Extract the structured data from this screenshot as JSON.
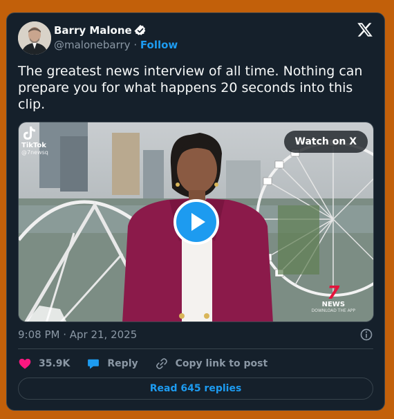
{
  "author": {
    "name": "Barry Malone",
    "handle": "@malonebarry",
    "separator": "·",
    "follow_label": "Follow"
  },
  "tweet": {
    "text": "The greatest news interview of all time. Nothing can prepare you for what happens 20 seconds into this clip."
  },
  "media": {
    "watch_label": "Watch on X",
    "overlay_tiktok": "TikTok",
    "overlay_tiktok_handle": "@7newsq",
    "overlay_channel_number": "7",
    "overlay_channel_name": "NEWS",
    "overlay_channel_sub": "DOWNLOAD THE APP"
  },
  "timestamp": "9:08 PM · Apr 21, 2025",
  "actions": {
    "likes": "35.9K",
    "reply_label": "Reply",
    "copy_label": "Copy link to post"
  },
  "read_replies_label": "Read 645 replies",
  "colors": {
    "accent": "#1d9bf0",
    "like": "#f91880",
    "card_bg": "#15202b",
    "page_bg": "#c2600a"
  }
}
